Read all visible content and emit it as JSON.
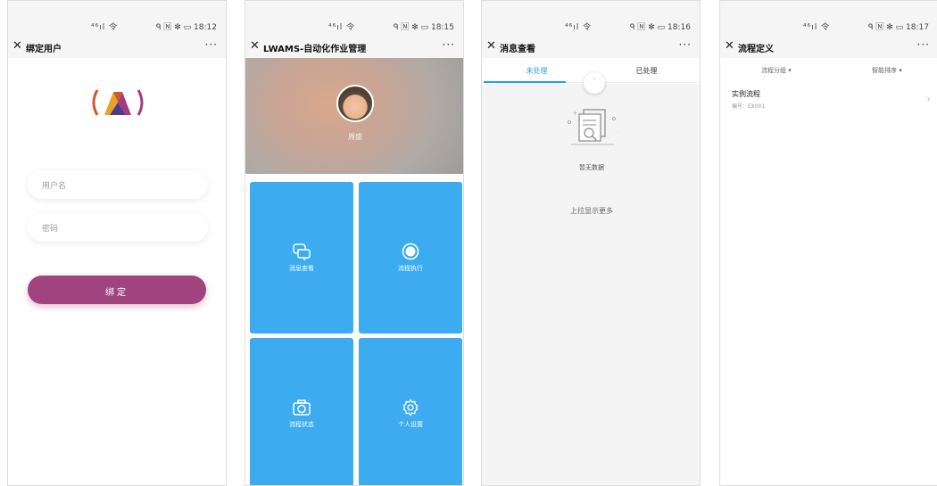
{
  "phones": [
    {
      "status": {
        "signal": "⁴⁶ıl 令",
        "right": "ᑫ 🄽 ✻ ▭ 18:12"
      },
      "title": "绑定用户",
      "more": "···",
      "username_placeholder": "用户名",
      "password_placeholder": "密码",
      "bind_label": "绑定"
    },
    {
      "status": {
        "signal": "⁴⁶ıl 令",
        "right": "ᑫ 🄽 ✻ ▭ 18:15"
      },
      "title": "LWAMS-自动化作业管理",
      "more": "···",
      "user_name": "周盛",
      "tiles": [
        {
          "label": "消息查看",
          "icon": "chat-icon"
        },
        {
          "label": "流程执行",
          "icon": "record-icon"
        },
        {
          "label": "流程状态",
          "icon": "camera-icon"
        },
        {
          "label": "个人设置",
          "icon": "gear-icon"
        }
      ]
    },
    {
      "status": {
        "signal": "⁴⁶ıl 令",
        "right": "ᑫ 🄽 ✻ ▭ 18:16"
      },
      "title": "消息查看",
      "more": "···",
      "tabs": [
        "未处理",
        "已处理"
      ],
      "empty_text": "暂无数据",
      "more_text": "上拉显示更多"
    },
    {
      "status": {
        "signal": "⁴⁶ıl 令",
        "right": "ᑫ 🄽 ✻ ▭ 18:17"
      },
      "title": "流程定义",
      "more": "···",
      "filters": [
        "流程分组 ▾",
        "智能排序 ▾"
      ],
      "items": [
        {
          "title": "实例流程",
          "code": "编号：EX001"
        }
      ]
    }
  ],
  "colors": {
    "bind_button": "#a0437e",
    "tile": "#3cabf0",
    "tab_active": "#2a9ee8"
  }
}
